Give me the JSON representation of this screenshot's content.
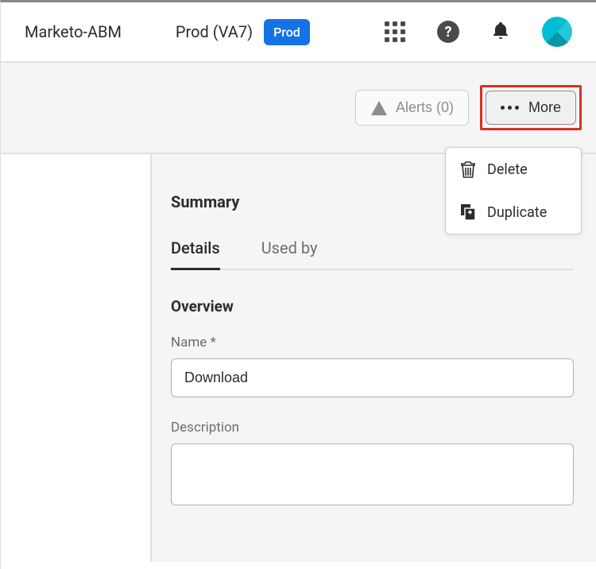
{
  "header": {
    "org": "Marketo-ABM",
    "env": "Prod (VA7)",
    "env_badge": "Prod"
  },
  "toolbar": {
    "alerts_label": "Alerts (0)",
    "more_label": "More"
  },
  "dropdown": {
    "delete_label": "Delete",
    "duplicate_label": "Duplicate"
  },
  "summary": {
    "heading": "Summary",
    "tabs": {
      "details": "Details",
      "used_by": "Used by"
    }
  },
  "overview": {
    "heading": "Overview",
    "name_label": "Name *",
    "name_value": "Download",
    "description_label": "Description",
    "description_value": ""
  }
}
